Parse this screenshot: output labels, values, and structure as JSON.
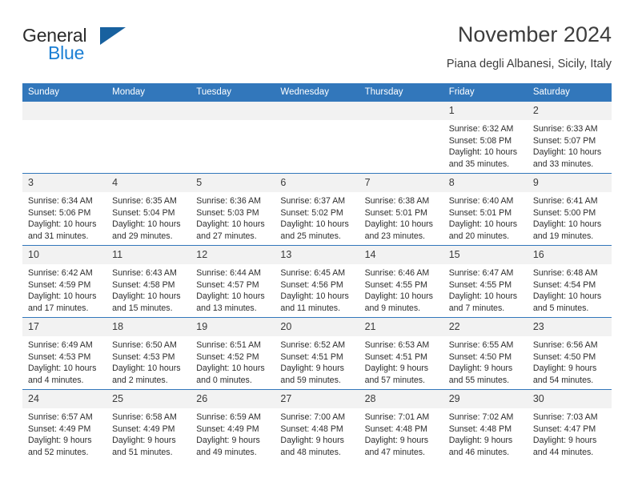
{
  "brand": {
    "name_dark": "General",
    "name_blue": "Blue"
  },
  "header": {
    "title": "November 2024",
    "subtitle": "Piana degli Albanesi, Sicily, Italy"
  },
  "colors": {
    "header_blue": "#3277bb",
    "logo_blue": "#1b7fd4",
    "logo_triangle": "#18619f",
    "daynum_band": "#f2f2f2",
    "text": "#2d2d2d"
  },
  "weekdays": [
    "Sunday",
    "Monday",
    "Tuesday",
    "Wednesday",
    "Thursday",
    "Friday",
    "Saturday"
  ],
  "weeks": [
    [
      {
        "day": "",
        "empty": true
      },
      {
        "day": "",
        "empty": true
      },
      {
        "day": "",
        "empty": true
      },
      {
        "day": "",
        "empty": true
      },
      {
        "day": "",
        "empty": true
      },
      {
        "day": "1",
        "sunrise": "Sunrise: 6:32 AM",
        "sunset": "Sunset: 5:08 PM",
        "daylight1": "Daylight: 10 hours",
        "daylight2": "and 35 minutes."
      },
      {
        "day": "2",
        "sunrise": "Sunrise: 6:33 AM",
        "sunset": "Sunset: 5:07 PM",
        "daylight1": "Daylight: 10 hours",
        "daylight2": "and 33 minutes."
      }
    ],
    [
      {
        "day": "3",
        "sunrise": "Sunrise: 6:34 AM",
        "sunset": "Sunset: 5:06 PM",
        "daylight1": "Daylight: 10 hours",
        "daylight2": "and 31 minutes."
      },
      {
        "day": "4",
        "sunrise": "Sunrise: 6:35 AM",
        "sunset": "Sunset: 5:04 PM",
        "daylight1": "Daylight: 10 hours",
        "daylight2": "and 29 minutes."
      },
      {
        "day": "5",
        "sunrise": "Sunrise: 6:36 AM",
        "sunset": "Sunset: 5:03 PM",
        "daylight1": "Daylight: 10 hours",
        "daylight2": "and 27 minutes."
      },
      {
        "day": "6",
        "sunrise": "Sunrise: 6:37 AM",
        "sunset": "Sunset: 5:02 PM",
        "daylight1": "Daylight: 10 hours",
        "daylight2": "and 25 minutes."
      },
      {
        "day": "7",
        "sunrise": "Sunrise: 6:38 AM",
        "sunset": "Sunset: 5:01 PM",
        "daylight1": "Daylight: 10 hours",
        "daylight2": "and 23 minutes."
      },
      {
        "day": "8",
        "sunrise": "Sunrise: 6:40 AM",
        "sunset": "Sunset: 5:01 PM",
        "daylight1": "Daylight: 10 hours",
        "daylight2": "and 20 minutes."
      },
      {
        "day": "9",
        "sunrise": "Sunrise: 6:41 AM",
        "sunset": "Sunset: 5:00 PM",
        "daylight1": "Daylight: 10 hours",
        "daylight2": "and 19 minutes."
      }
    ],
    [
      {
        "day": "10",
        "sunrise": "Sunrise: 6:42 AM",
        "sunset": "Sunset: 4:59 PM",
        "daylight1": "Daylight: 10 hours",
        "daylight2": "and 17 minutes."
      },
      {
        "day": "11",
        "sunrise": "Sunrise: 6:43 AM",
        "sunset": "Sunset: 4:58 PM",
        "daylight1": "Daylight: 10 hours",
        "daylight2": "and 15 minutes."
      },
      {
        "day": "12",
        "sunrise": "Sunrise: 6:44 AM",
        "sunset": "Sunset: 4:57 PM",
        "daylight1": "Daylight: 10 hours",
        "daylight2": "and 13 minutes."
      },
      {
        "day": "13",
        "sunrise": "Sunrise: 6:45 AM",
        "sunset": "Sunset: 4:56 PM",
        "daylight1": "Daylight: 10 hours",
        "daylight2": "and 11 minutes."
      },
      {
        "day": "14",
        "sunrise": "Sunrise: 6:46 AM",
        "sunset": "Sunset: 4:55 PM",
        "daylight1": "Daylight: 10 hours",
        "daylight2": "and 9 minutes."
      },
      {
        "day": "15",
        "sunrise": "Sunrise: 6:47 AM",
        "sunset": "Sunset: 4:55 PM",
        "daylight1": "Daylight: 10 hours",
        "daylight2": "and 7 minutes."
      },
      {
        "day": "16",
        "sunrise": "Sunrise: 6:48 AM",
        "sunset": "Sunset: 4:54 PM",
        "daylight1": "Daylight: 10 hours",
        "daylight2": "and 5 minutes."
      }
    ],
    [
      {
        "day": "17",
        "sunrise": "Sunrise: 6:49 AM",
        "sunset": "Sunset: 4:53 PM",
        "daylight1": "Daylight: 10 hours",
        "daylight2": "and 4 minutes."
      },
      {
        "day": "18",
        "sunrise": "Sunrise: 6:50 AM",
        "sunset": "Sunset: 4:53 PM",
        "daylight1": "Daylight: 10 hours",
        "daylight2": "and 2 minutes."
      },
      {
        "day": "19",
        "sunrise": "Sunrise: 6:51 AM",
        "sunset": "Sunset: 4:52 PM",
        "daylight1": "Daylight: 10 hours",
        "daylight2": "and 0 minutes."
      },
      {
        "day": "20",
        "sunrise": "Sunrise: 6:52 AM",
        "sunset": "Sunset: 4:51 PM",
        "daylight1": "Daylight: 9 hours",
        "daylight2": "and 59 minutes."
      },
      {
        "day": "21",
        "sunrise": "Sunrise: 6:53 AM",
        "sunset": "Sunset: 4:51 PM",
        "daylight1": "Daylight: 9 hours",
        "daylight2": "and 57 minutes."
      },
      {
        "day": "22",
        "sunrise": "Sunrise: 6:55 AM",
        "sunset": "Sunset: 4:50 PM",
        "daylight1": "Daylight: 9 hours",
        "daylight2": "and 55 minutes."
      },
      {
        "day": "23",
        "sunrise": "Sunrise: 6:56 AM",
        "sunset": "Sunset: 4:50 PM",
        "daylight1": "Daylight: 9 hours",
        "daylight2": "and 54 minutes."
      }
    ],
    [
      {
        "day": "24",
        "sunrise": "Sunrise: 6:57 AM",
        "sunset": "Sunset: 4:49 PM",
        "daylight1": "Daylight: 9 hours",
        "daylight2": "and 52 minutes."
      },
      {
        "day": "25",
        "sunrise": "Sunrise: 6:58 AM",
        "sunset": "Sunset: 4:49 PM",
        "daylight1": "Daylight: 9 hours",
        "daylight2": "and 51 minutes."
      },
      {
        "day": "26",
        "sunrise": "Sunrise: 6:59 AM",
        "sunset": "Sunset: 4:49 PM",
        "daylight1": "Daylight: 9 hours",
        "daylight2": "and 49 minutes."
      },
      {
        "day": "27",
        "sunrise": "Sunrise: 7:00 AM",
        "sunset": "Sunset: 4:48 PM",
        "daylight1": "Daylight: 9 hours",
        "daylight2": "and 48 minutes."
      },
      {
        "day": "28",
        "sunrise": "Sunrise: 7:01 AM",
        "sunset": "Sunset: 4:48 PM",
        "daylight1": "Daylight: 9 hours",
        "daylight2": "and 47 minutes."
      },
      {
        "day": "29",
        "sunrise": "Sunrise: 7:02 AM",
        "sunset": "Sunset: 4:48 PM",
        "daylight1": "Daylight: 9 hours",
        "daylight2": "and 46 minutes."
      },
      {
        "day": "30",
        "sunrise": "Sunrise: 7:03 AM",
        "sunset": "Sunset: 4:47 PM",
        "daylight1": "Daylight: 9 hours",
        "daylight2": "and 44 minutes."
      }
    ]
  ]
}
